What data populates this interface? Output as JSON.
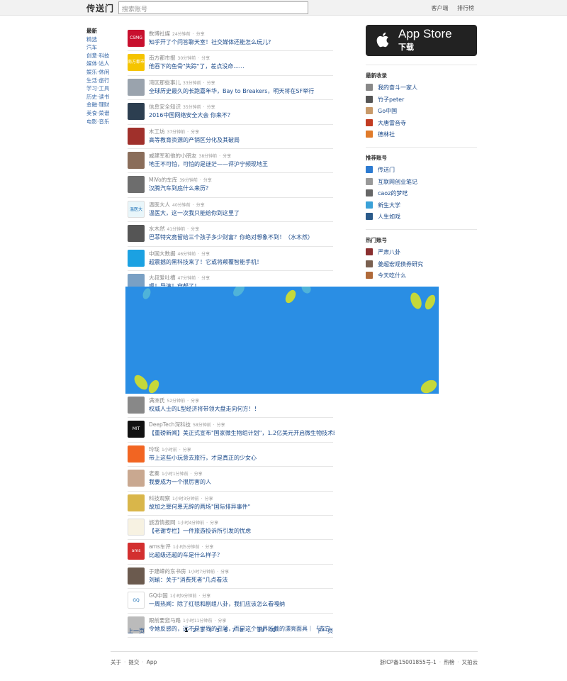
{
  "header": {
    "logo": "传送门",
    "search_placeholder": "搜索账号",
    "links": [
      "客户端",
      "排行榜"
    ]
  },
  "nav": [
    "最新",
    "精选",
    "汽车",
    "创意·科技",
    "媒体·达人",
    "娱乐·休闲",
    "生活·旅行",
    "学习·工具",
    "历史·读书",
    "金融·理财",
    "美食·菜谱",
    "电影·音乐"
  ],
  "feed_top": [
    {
      "source": "数博社媒",
      "time": "24分钟前",
      "share": "分享",
      "title": "知乎开了个问答聊天室！社交媒体还能怎么玩儿?",
      "thumb_color": "#c8102e",
      "thumb_text": "CSMG"
    },
    {
      "source": "南方都市报",
      "time": "30分钟前",
      "share": "分享",
      "title": "他吞下的鱼骨\"失踪\"了，差点没命......",
      "thumb_color": "#f5c400",
      "thumb_text": "南方都市报"
    },
    {
      "source": "湾区那些事儿",
      "time": "33分钟前",
      "share": "分享",
      "title": "全球历史最久的长跑嘉年华，Bay to Breakers，明天将在SF举行",
      "thumb_color": "#9aa3ad",
      "thumb_text": ""
    },
    {
      "source": "信息安全知识",
      "time": "35分钟前",
      "share": "分享",
      "title": "2016中国网络安全大会 你来不？",
      "thumb_color": "#2c3e50",
      "thumb_text": ""
    },
    {
      "source": "木工坊",
      "time": "37分钟前",
      "share": "分享",
      "title": "高等教育资源的产销区分化及其破局",
      "thumb_color": "#a0302b",
      "thumb_text": ""
    },
    {
      "source": "威建军和他的小朋友",
      "time": "38分钟前",
      "share": "分享",
      "title": "地王不可怕，可怕的是谜茫——评沪宁频现地王",
      "thumb_color": "#8a6d5a",
      "thumb_text": ""
    },
    {
      "source": "MiVo的车库",
      "time": "39分钟前",
      "share": "分享",
      "title": "汉腾汽车到底什么来历？",
      "thumb_color": "#6d6d6d",
      "thumb_text": ""
    },
    {
      "source": "温医大人",
      "time": "40分钟前",
      "share": "分享",
      "title": "温医大，这一次我只能给你到这里了",
      "thumb_color": "#e9f6fa",
      "thumb_text": "温医大人"
    },
    {
      "source": "水木然",
      "time": "41分钟前",
      "share": "分享",
      "title": "巴菲特究竟留给三个孩子多少财富？你绝对想象不到！（水木然）",
      "thumb_color": "#555555",
      "thumb_text": ""
    },
    {
      "source": "中国大数据",
      "time": "46分钟前",
      "share": "分享",
      "title": "超震撼的黑科技来了！它或将颠覆智能手机！",
      "thumb_color": "#1ba1e2",
      "thumb_text": ""
    },
    {
      "source": "大叔爱吐槽",
      "time": "47分钟前",
      "share": "分享",
      "title": "嗯！导演！穿帮了！",
      "thumb_color": "#7aa0c4",
      "thumb_text": ""
    }
  ],
  "feed_bottom": [
    {
      "source": "满洲氏",
      "time": "52分钟前",
      "share": "分享",
      "title": "权威人士的L型经济将带领大盘走向何方！！",
      "thumb_color": "#888888",
      "thumb_text": ""
    },
    {
      "source": "DeepTech深科技",
      "time": "58分钟前",
      "share": "分享",
      "title": "【重磅新闻】美正式宣布\"国家微生物组计划\"，1.2亿美元开启微生物技术时代",
      "thumb_color": "#111111",
      "thumb_text": "MIT"
    },
    {
      "source": "玲珑",
      "time": "1小时前",
      "share": "分享",
      "title": "带上这些小玩意去旅行，才是真正的少女心",
      "thumb_color": "#f26522",
      "thumb_text": ""
    },
    {
      "source": "老秦",
      "time": "1小时1分钟前",
      "share": "分享",
      "title": "我要成为一个很厉害的人",
      "thumb_color": "#c9a890",
      "thumb_text": ""
    },
    {
      "source": "科技观察",
      "time": "1小时3分钟前",
      "share": "分享",
      "title": "故加之罪何患无辞的两场\"国际排异事件\"",
      "thumb_color": "#d9b64a",
      "thumb_text": ""
    },
    {
      "source": "旅游情报网",
      "time": "1小时4分钟前",
      "share": "分享",
      "title": "【老谢专栏】一件旅游投诉所引发的忧虑",
      "thumb_color": "#f7f2e2",
      "thumb_text": ""
    },
    {
      "source": "ams车评",
      "time": "1小时5分钟前",
      "share": "分享",
      "title": "比超级还超的车是什么样子？",
      "thumb_color": "#d32f2f",
      "thumb_text": "ams"
    },
    {
      "source": "于建嵘的东书房",
      "time": "1小时7分钟前",
      "share": "分享",
      "title": "刘瑜：关于\"消费死者\"几点看法",
      "thumb_color": "#6b5a4e",
      "thumb_text": ""
    },
    {
      "source": "GQ中国",
      "time": "1小时9分钟前",
      "share": "分享",
      "title": "一周热闻：除了红毯和剧组八卦，我们应该怎么看嘎纳",
      "thumb_color": "#ffffff",
      "thumb_text": "GQ"
    },
    {
      "source": "跟前要逛马路",
      "time": "1小时11分钟前",
      "share": "分享",
      "title": "令她反感的，远不是世界的丑陋，而是这个世界所戴的漂亮面具｜「游它，去逛！」",
      "thumb_color": "#bbbbbb",
      "thumb_text": ""
    }
  ],
  "pager": {
    "prev": "上一页",
    "next": "下一页",
    "pages": [
      "1",
      "2",
      "3",
      "4",
      "5",
      "6",
      "7",
      "8",
      "...",
      "39",
      "40"
    ],
    "current": "1"
  },
  "appstore": {
    "line1": "App Store",
    "line2": "下载"
  },
  "sidebar": {
    "latest_title": "最新收录",
    "latest": [
      {
        "name": "我的奋斗一家人",
        "color": "#888888"
      },
      {
        "name": "竹子peter",
        "color": "#555555"
      },
      {
        "name": "Go中国",
        "color": "#c89a6a"
      },
      {
        "name": "大唐雷音寺",
        "color": "#c23b22"
      },
      {
        "name": "德林社",
        "color": "#e07b2a"
      }
    ],
    "recommend_title": "推荐账号",
    "recommend": [
      {
        "name": "传送门",
        "color": "#2d7bd1"
      },
      {
        "name": "互联网创业笔记",
        "color": "#999999"
      },
      {
        "name": "caoz的梦呓",
        "color": "#666666"
      },
      {
        "name": "新生大学",
        "color": "#3aa1d8"
      },
      {
        "name": "人生如戏",
        "color": "#2a5a8a"
      }
    ],
    "hot_title": "热门账号",
    "hot": [
      {
        "name": "严肃八卦",
        "color": "#8a3030"
      },
      {
        "name": "姜超宏观债券研究",
        "color": "#7a6050"
      },
      {
        "name": "今天吃什么",
        "color": "#b06a3a"
      }
    ]
  },
  "footer": {
    "left": [
      "关于",
      "提交",
      "App"
    ],
    "right": [
      "浙ICP备15001855号-1",
      "热榜",
      "又拍云"
    ]
  }
}
